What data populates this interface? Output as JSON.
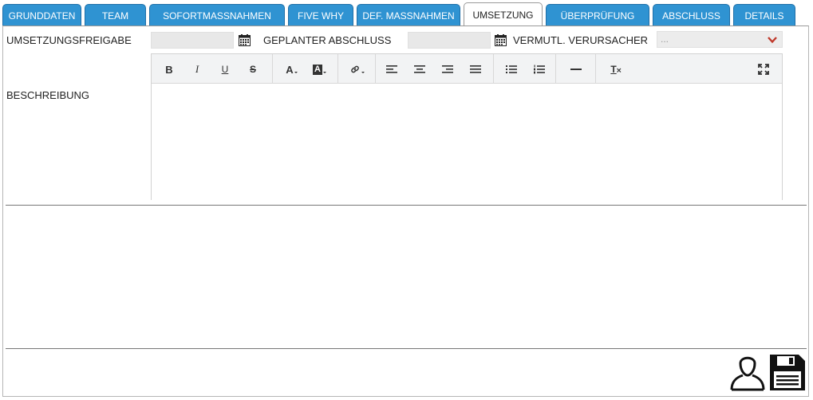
{
  "tabs": [
    {
      "label": "GRUNDDATEN",
      "active": false
    },
    {
      "label": "TEAM",
      "active": false
    },
    {
      "label": "SOFORTMASSNAHMEN",
      "active": false
    },
    {
      "label": "FIVE WHY",
      "active": false
    },
    {
      "label": "DEF. MASSNAHMEN",
      "active": false
    },
    {
      "label": "UMSETZUNG",
      "active": true
    },
    {
      "label": "ÜBERPRÜFUNG",
      "active": false
    },
    {
      "label": "ABSCHLUSS",
      "active": false
    },
    {
      "label": "DETAILS",
      "active": false
    }
  ],
  "form": {
    "release_label": "UMSETZUNGSFREIGABE",
    "release_value": "",
    "planned_label": "GEPLANTER ABSCHLUSS",
    "planned_value": "",
    "cause_label": "VERMUTL. VERURSACHER",
    "cause_placeholder": "...",
    "description_label": "BESCHREIBUNG",
    "description_value": ""
  },
  "toolbar": {
    "bold": "B",
    "italic": "I",
    "underline": "U",
    "strike": "S",
    "font_color": "A",
    "bg_color": "A",
    "clear_format": "T"
  },
  "colors": {
    "tab_blue": "#2f93d2",
    "chevron_red": "#c0392b"
  },
  "icons": [
    "calendar-icon",
    "chevron-down-icon",
    "link-icon",
    "align-left-icon",
    "align-center-icon",
    "align-right-icon",
    "align-justify-icon",
    "bullet-list-icon",
    "numbered-list-icon",
    "horizontal-rule-icon",
    "clear-format-icon",
    "fullscreen-icon",
    "user-icon",
    "save-icon"
  ]
}
